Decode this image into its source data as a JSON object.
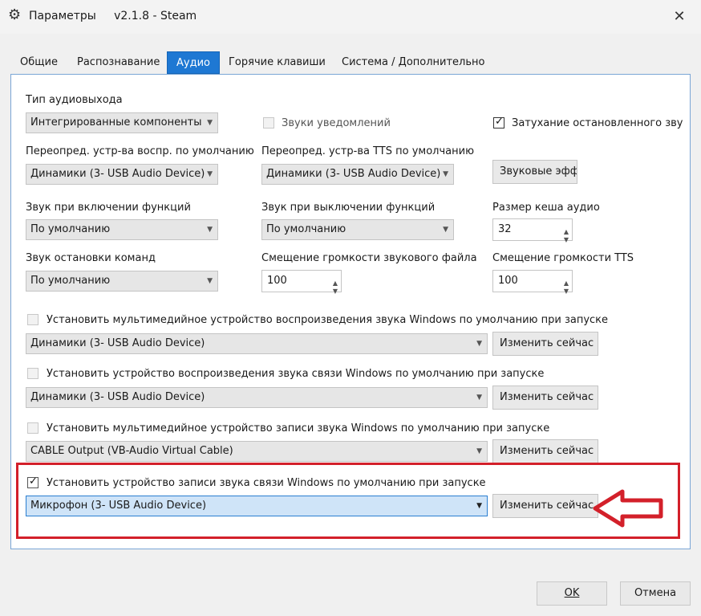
{
  "window": {
    "title": "Параметры     v2.1.8 - Steam",
    "close_glyph": "✕",
    "icon": "gear-icon"
  },
  "tabs": [
    {
      "label": "Общие",
      "active": false
    },
    {
      "label": "Распознавание",
      "active": false
    },
    {
      "label": "Аудио",
      "active": true
    },
    {
      "label": "Горячие клавиши",
      "active": false
    },
    {
      "label": "Система / Дополнительно",
      "active": false
    }
  ],
  "audio": {
    "output_type": {
      "label": "Тип аудиовыхода",
      "value": "Интегрированные компоненты"
    },
    "notify_sounds": {
      "label": "Звуки уведомлений",
      "checked": false
    },
    "fade_stopped": {
      "label": "Затухание остановленного звука",
      "checked": true
    },
    "override_playback": {
      "label": "Переопред. устр-ва воспр. по умолчанию",
      "value": "Динамики (3- USB Audio Device)"
    },
    "override_tts": {
      "label": "Переопред. устр-ва TTS по умолчанию",
      "value": "Динамики (3- USB Audio Device)"
    },
    "sound_effects_button": "Звуковые эффекты",
    "sound_on_enable": {
      "label": "Звук при включении функций",
      "value": "По умолчанию"
    },
    "sound_on_disable": {
      "label": "Звук при выключении функций",
      "value": "По умолчанию"
    },
    "cache_size": {
      "label": "Размер кеша аудио",
      "value": "32"
    },
    "sound_stop_commands": {
      "label": "Звук остановки команд",
      "value": "По умолчанию"
    },
    "file_volume_offset": {
      "label": "Смещение громкости звукового файла",
      "value": "100"
    },
    "tts_volume_offset": {
      "label": "Смещение громкости TTS",
      "value": "100"
    },
    "default_devices": [
      {
        "label": "Установить мультимедийное устройство воспроизведения звука Windows по умолчанию при запуске",
        "checked": false,
        "value": "Динамики (3- USB Audio Device)",
        "button": "Изменить сейчас",
        "highlighted": false
      },
      {
        "label": "Установить устройство воспроизведения звука связи Windows по умолчанию при запуске",
        "checked": false,
        "value": "Динамики (3- USB Audio Device)",
        "button": "Изменить сейчас",
        "highlighted": false
      },
      {
        "label": "Установить мультимедийное устройство записи звука Windows по умолчанию при запуске",
        "checked": false,
        "value": "CABLE Output (VB-Audio Virtual Cable)",
        "button": "Изменить сейчас",
        "highlighted": false
      },
      {
        "label": "Установить устройство записи звука связи Windows по умолчанию при запуске",
        "checked": true,
        "value": "Микрофон (3- USB Audio Device)",
        "button": "Изменить сейчас",
        "highlighted": true
      }
    ]
  },
  "footer": {
    "ok": "OK",
    "cancel": "Отмена"
  },
  "colors": {
    "accent": "#1e78d3",
    "highlight_box": "#d3202a",
    "selected_combo": "#cfe4f8"
  }
}
